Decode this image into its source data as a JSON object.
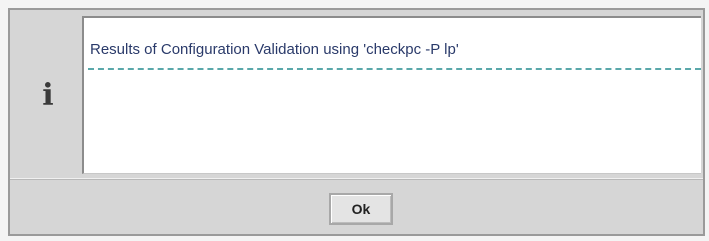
{
  "dialog": {
    "icon": {
      "name": "info-icon",
      "glyph": "i"
    },
    "message": "Results of Configuration Validation using 'checkpc -P lp'",
    "ok_label": "Ok",
    "colors": {
      "separator": "#5aa8aa",
      "message_text": "#2a3a6a"
    }
  }
}
